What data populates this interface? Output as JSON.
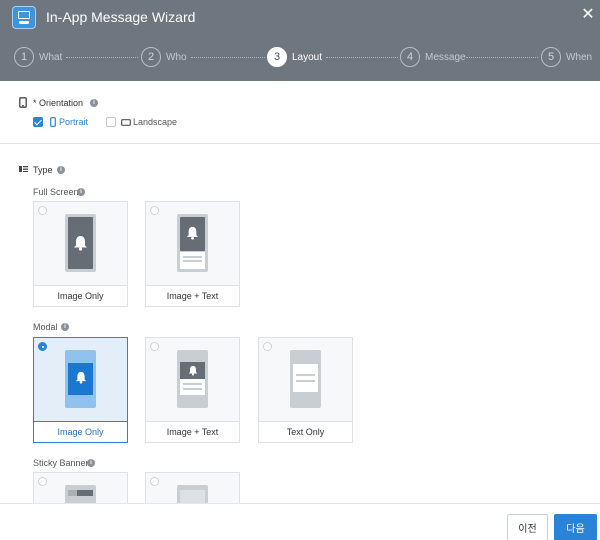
{
  "window": {
    "title": "In-App Message Wizard",
    "close_icon": "close-icon"
  },
  "stepper": {
    "steps": [
      {
        "num": "1",
        "label": "What"
      },
      {
        "num": "2",
        "label": "Who"
      },
      {
        "num": "3",
        "label": "Layout"
      },
      {
        "num": "4",
        "label": "Message"
      },
      {
        "num": "5",
        "label": "When"
      }
    ],
    "active": 3
  },
  "orientation": {
    "label": "* Orientation",
    "options": [
      {
        "label": "Portrait",
        "checked": true
      },
      {
        "label": "Landscape",
        "checked": false
      }
    ]
  },
  "type": {
    "label": "Type",
    "full_screen": {
      "label": "Full Screen",
      "cards": [
        {
          "label": "Image Only"
        },
        {
          "label": "Image + Text"
        }
      ]
    },
    "modal": {
      "label": "Modal",
      "cards": [
        {
          "label": "Image Only",
          "selected": true
        },
        {
          "label": "Image + Text"
        },
        {
          "label": "Text Only"
        }
      ]
    },
    "sticky_banner": {
      "label": "Sticky Banner"
    }
  },
  "footer": {
    "prev_label": "이전",
    "next_label": "다음"
  },
  "colors": {
    "accent": "#2a83d6",
    "header": "#6e7780"
  }
}
